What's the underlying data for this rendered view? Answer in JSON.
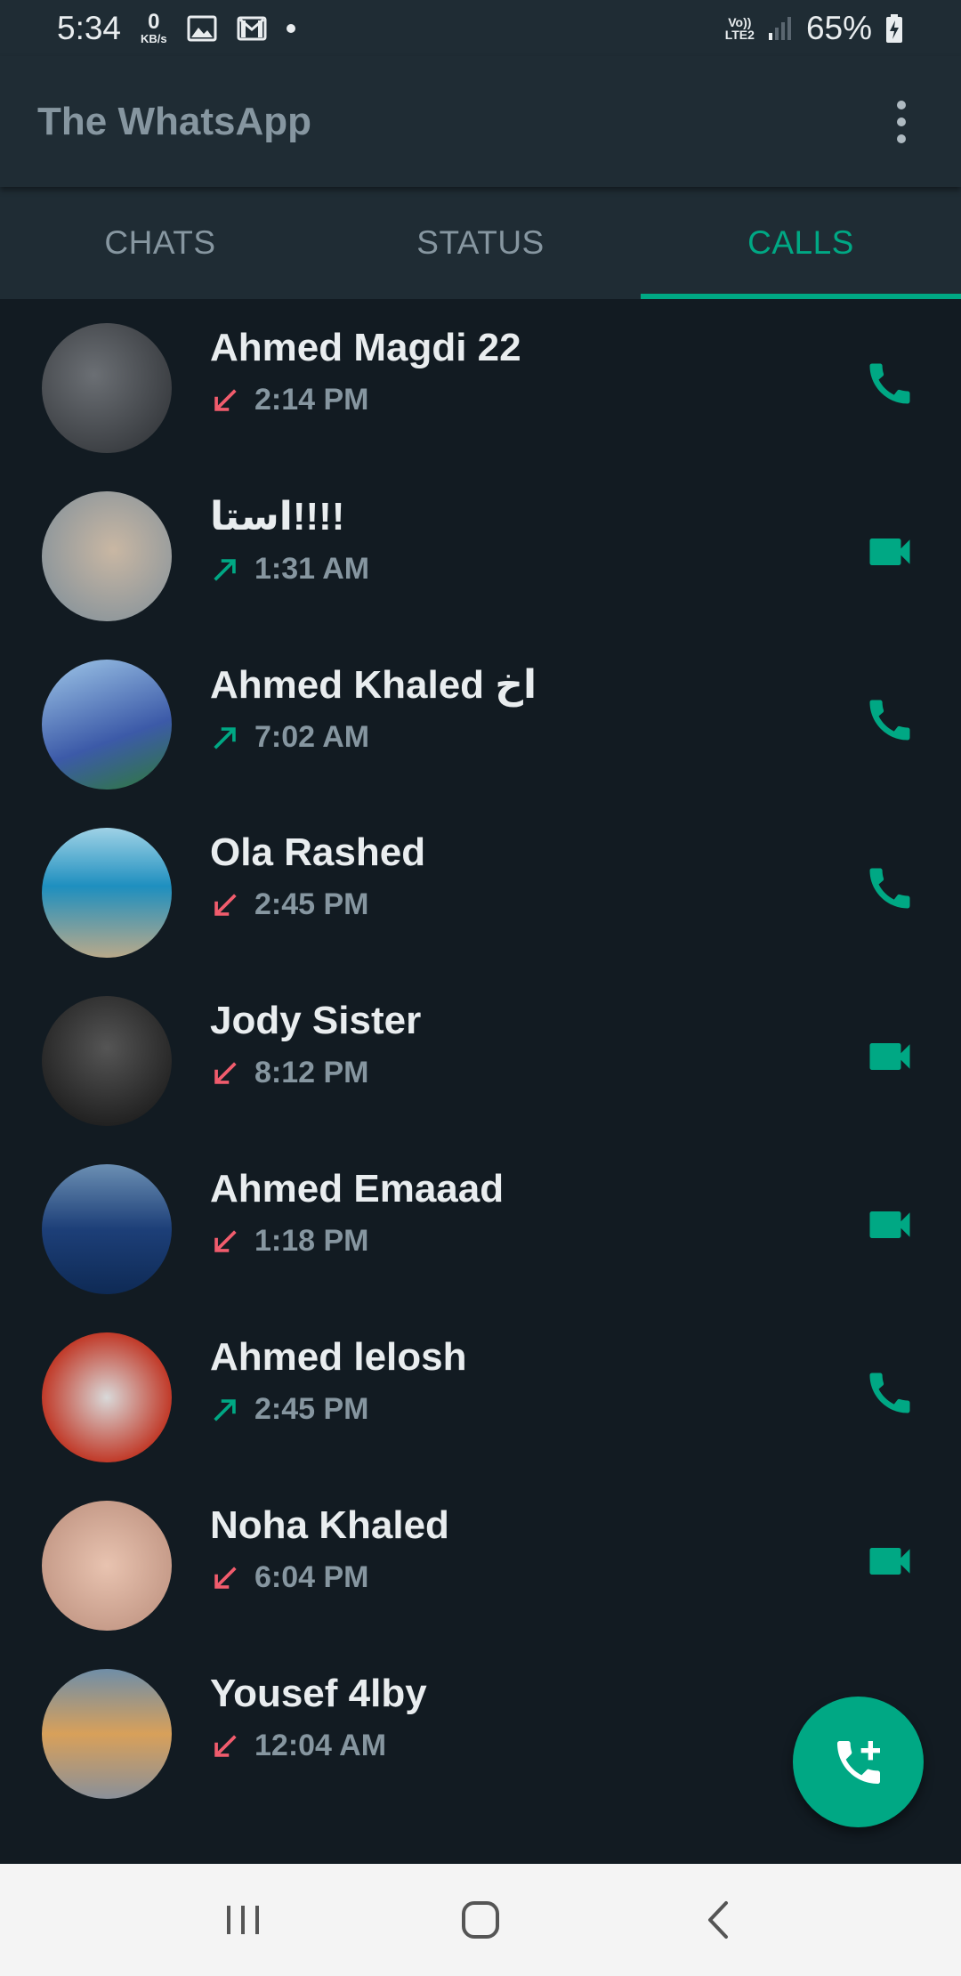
{
  "status_bar": {
    "time": "5:34",
    "net_speed_value": "0",
    "net_speed_unit": "KB/s",
    "volte_top": "Vo))",
    "volte_bottom": "LTE2",
    "battery": "65%"
  },
  "app": {
    "title": "The WhatsApp"
  },
  "tabs": [
    {
      "label": "CHATS",
      "active": false
    },
    {
      "label": "STATUS",
      "active": false
    },
    {
      "label": "CALLS",
      "active": true
    }
  ],
  "colors": {
    "accent": "#00a884",
    "missed": "#f15c6d",
    "background": "#121b22",
    "bar": "#1f2c34"
  },
  "calls": [
    {
      "name": "Ahmed Magdi 22",
      "time": "2:14 PM",
      "direction": "missed",
      "type": "voice"
    },
    {
      "name": "استا!!!!",
      "time": "1:31 AM",
      "direction": "outgoing",
      "type": "video"
    },
    {
      "name": "Ahmed Khaled اخ",
      "time": "7:02 AM",
      "direction": "outgoing",
      "type": "voice"
    },
    {
      "name": "Ola Rashed",
      "time": "2:45 PM",
      "direction": "missed",
      "type": "voice"
    },
    {
      "name": "Jody Sister",
      "time": "8:12 PM",
      "direction": "missed",
      "type": "video"
    },
    {
      "name": "Ahmed Emaaad",
      "time": "1:18 PM",
      "direction": "missed",
      "type": "video"
    },
    {
      "name": "Ahmed lelosh",
      "time": "2:45 PM",
      "direction": "outgoing",
      "type": "voice"
    },
    {
      "name": "Noha Khaled",
      "time": "6:04 PM",
      "direction": "missed",
      "type": "video"
    },
    {
      "name": "Yousef 4lby",
      "time": "12:04 AM",
      "direction": "missed",
      "type": "none"
    }
  ],
  "icons": {
    "menu": "more-vert-icon",
    "fab": "add-call-icon",
    "voice": "phone-icon",
    "video": "videocam-icon",
    "missed": "arrow-down-left-icon",
    "outgoing": "arrow-up-right-icon"
  }
}
